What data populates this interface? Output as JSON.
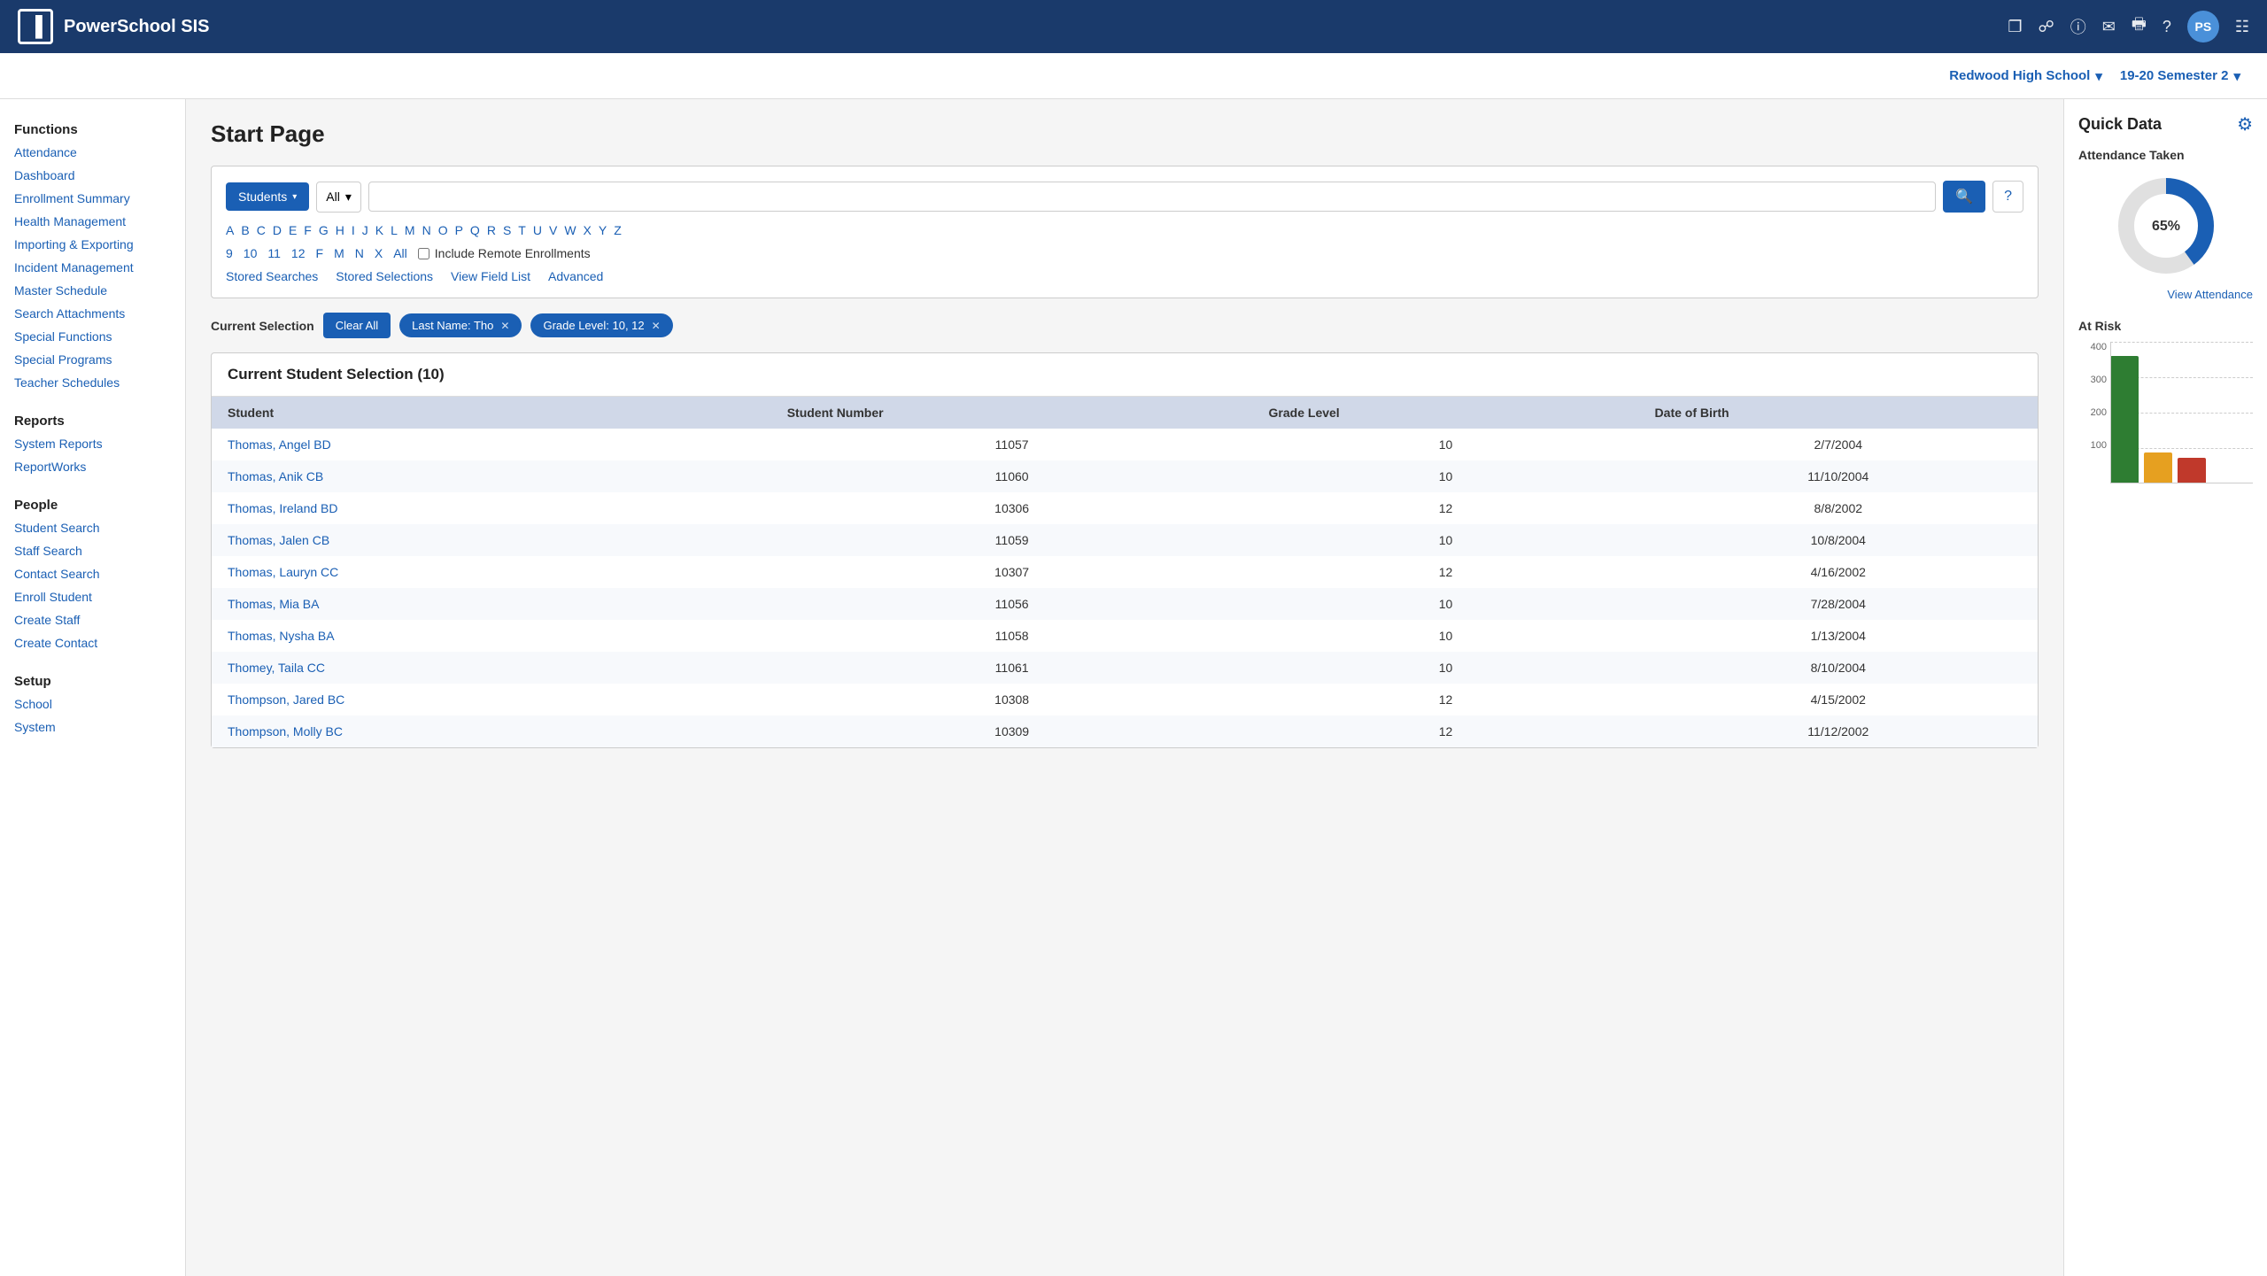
{
  "app": {
    "name": "PowerSchool SIS",
    "logo_text": "P"
  },
  "top_nav": {
    "icons": [
      "edit-icon",
      "translate-icon",
      "info-icon",
      "mail-icon",
      "print-icon",
      "help-icon",
      "avatar-icon",
      "grid-icon"
    ],
    "avatar_initials": "PS"
  },
  "sub_header": {
    "school_name": "Redwood High School",
    "semester": "19-20 Semester 2",
    "chevron": "▾"
  },
  "sidebar": {
    "functions_title": "Functions",
    "functions_items": [
      "Attendance",
      "Dashboard",
      "Enrollment Summary",
      "Health Management",
      "Importing & Exporting",
      "Incident Management",
      "Master Schedule",
      "Search Attachments",
      "Special Functions",
      "Special Programs",
      "Teacher Schedules"
    ],
    "reports_title": "Reports",
    "reports_items": [
      "System Reports",
      "ReportWorks"
    ],
    "people_title": "People",
    "people_items": [
      "Student Search",
      "Staff Search",
      "Contact Search",
      "Enroll Student",
      "Create Staff",
      "Create Contact"
    ],
    "setup_title": "Setup",
    "setup_items": [
      "School",
      "System"
    ]
  },
  "main": {
    "page_title": "Start Page",
    "search": {
      "type_label": "Students",
      "grade_label": "All",
      "search_placeholder": "",
      "stored_searches": "Stored Searches",
      "stored_selections": "Stored Selections",
      "view_field_list": "View Field List",
      "advanced": "Advanced",
      "include_remote": "Include Remote Enrollments",
      "alpha": [
        "A",
        "B",
        "C",
        "D",
        "E",
        "F",
        "G",
        "H",
        "I",
        "J",
        "K",
        "L",
        "M",
        "N",
        "O",
        "P",
        "Q",
        "R",
        "S",
        "T",
        "U",
        "V",
        "W",
        "X",
        "Y",
        "Z"
      ],
      "grades": [
        "9",
        "10",
        "11",
        "12",
        "F",
        "M",
        "N",
        "X",
        "All"
      ]
    },
    "current_selection": {
      "label": "Current Selection",
      "clear_all": "Clear All",
      "filters": [
        {
          "text": "Last Name: Tho",
          "id": "filter-lastname"
        },
        {
          "text": "Grade Level: 10, 12",
          "id": "filter-grade"
        }
      ]
    },
    "student_table": {
      "title": "Current Student Selection (10)",
      "columns": [
        "Student",
        "Student Number",
        "Grade Level",
        "Date of Birth"
      ],
      "rows": [
        {
          "name": "Thomas, Angel BD",
          "number": "11057",
          "grade": "10",
          "dob": "2/7/2004"
        },
        {
          "name": "Thomas, Anik CB",
          "number": "11060",
          "grade": "10",
          "dob": "11/10/2004"
        },
        {
          "name": "Thomas, Ireland BD",
          "number": "10306",
          "grade": "12",
          "dob": "8/8/2002"
        },
        {
          "name": "Thomas, Jalen CB",
          "number": "11059",
          "grade": "10",
          "dob": "10/8/2004"
        },
        {
          "name": "Thomas, Lauryn CC",
          "number": "10307",
          "grade": "12",
          "dob": "4/16/2002"
        },
        {
          "name": "Thomas, Mia BA",
          "number": "11056",
          "grade": "10",
          "dob": "7/28/2004"
        },
        {
          "name": "Thomas, Nysha BA",
          "number": "11058",
          "grade": "10",
          "dob": "1/13/2004"
        },
        {
          "name": "Thomey, Taila CC",
          "number": "11061",
          "grade": "10",
          "dob": "8/10/2004"
        },
        {
          "name": "Thompson, Jared BC",
          "number": "10308",
          "grade": "12",
          "dob": "4/15/2002"
        },
        {
          "name": "Thompson, Molly BC",
          "number": "10309",
          "grade": "12",
          "dob": "11/12/2002"
        }
      ]
    }
  },
  "quick_data": {
    "title": "Quick Data",
    "attendance": {
      "title": "Attendance Taken",
      "percentage": 65,
      "percentage_label": "65%",
      "view_link": "View Attendance"
    },
    "at_risk": {
      "title": "At Risk",
      "y_labels": [
        "400",
        "300",
        "200",
        "100"
      ],
      "bars": [
        {
          "color": "green",
          "height_pct": 90,
          "label": ""
        },
        {
          "color": "orange",
          "height_pct": 22,
          "label": ""
        },
        {
          "color": "red",
          "height_pct": 18,
          "label": ""
        }
      ]
    }
  },
  "colors": {
    "primary_blue": "#1a5fb4",
    "nav_bg": "#1a3a6b",
    "donut_blue": "#1a5fb4",
    "donut_gray": "#e0e0e0"
  }
}
